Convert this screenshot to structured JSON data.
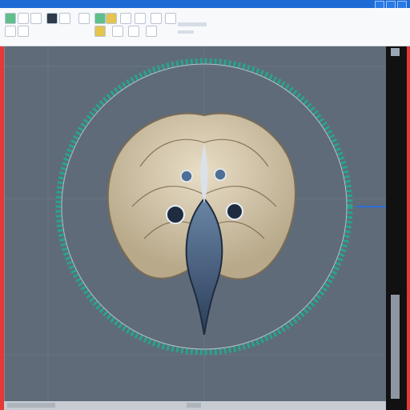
{
  "window": {
    "title_bar_color": "#1f6bd6"
  },
  "toolbar": {
    "buttons": [
      {
        "name": "new-icon"
      },
      {
        "name": "open-icon"
      },
      {
        "name": "save-icon"
      },
      {
        "name": "undo-icon"
      },
      {
        "name": "redo-icon"
      },
      {
        "name": "select-icon"
      },
      {
        "name": "brush-icon"
      },
      {
        "name": "eraser-icon"
      },
      {
        "name": "fill-icon"
      },
      {
        "name": "text-icon"
      },
      {
        "name": "zoom-icon"
      },
      {
        "name": "settings-icon"
      }
    ]
  },
  "canvas": {
    "background": "#5f6b79",
    "ring_color": "#2aa38a",
    "art_color": "#c8b89c"
  }
}
